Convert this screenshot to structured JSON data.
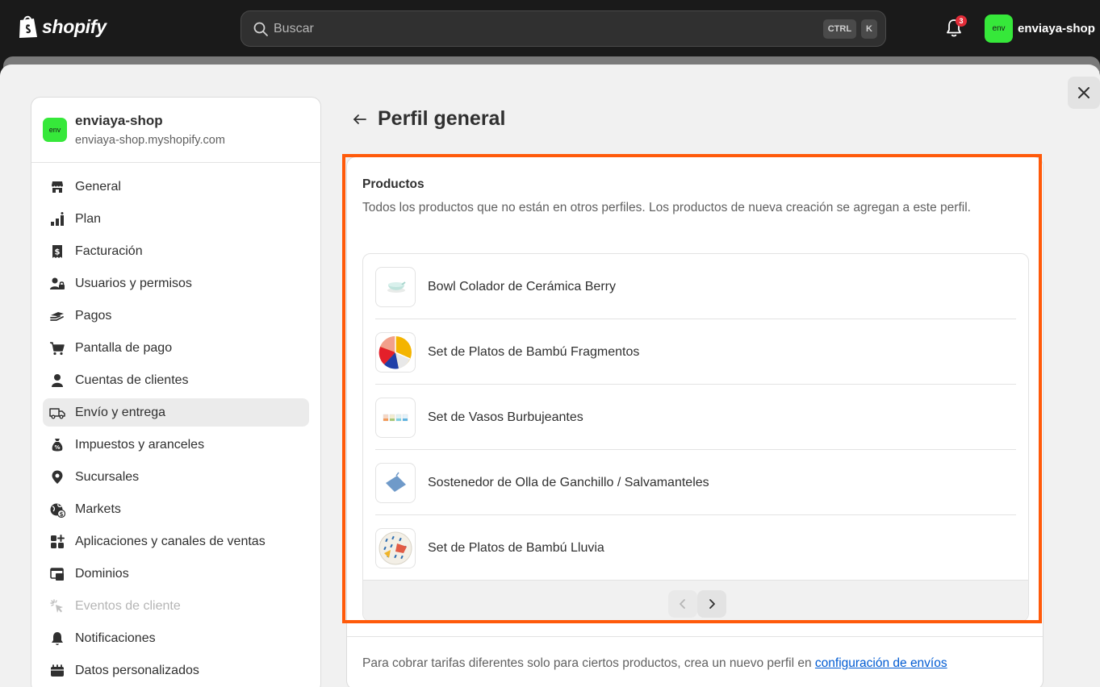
{
  "topbar": {
    "brand": "shopify",
    "search_placeholder": "Buscar",
    "shortcut_keys": [
      "CTRL",
      "K"
    ],
    "notification_count": "3",
    "store_avatar": "env",
    "store_name": "enviaya-shop"
  },
  "colors": {
    "accent_highlight": "#ff5a0a",
    "avatar_green": "#36e83a",
    "badge_red": "#e22c38",
    "link_blue": "#005bd3"
  },
  "sidebar": {
    "avatar": "env",
    "store_name": "enviaya-shop",
    "store_domain": "enviaya-shop.myshopify.com",
    "items": [
      {
        "label": "General",
        "icon": "store-icon"
      },
      {
        "label": "Plan",
        "icon": "plan-icon"
      },
      {
        "label": "Facturación",
        "icon": "receipt-dollar-icon"
      },
      {
        "label": "Usuarios y permisos",
        "icon": "users-lock-icon"
      },
      {
        "label": "Pagos",
        "icon": "hand-payment-icon"
      },
      {
        "label": "Pantalla de pago",
        "icon": "cart-icon"
      },
      {
        "label": "Cuentas de clientes",
        "icon": "person-icon"
      },
      {
        "label": "Envío y entrega",
        "icon": "truck-icon",
        "active": true
      },
      {
        "label": "Impuestos y aranceles",
        "icon": "tax-bag-icon"
      },
      {
        "label": "Sucursales",
        "icon": "location-pin-icon"
      },
      {
        "label": "Markets",
        "icon": "globe-dollar-icon"
      },
      {
        "label": "Aplicaciones y canales de ventas",
        "icon": "apps-icon"
      },
      {
        "label": "Dominios",
        "icon": "domains-icon"
      },
      {
        "label": "Eventos de cliente",
        "icon": "cursor-click-icon",
        "disabled": true
      },
      {
        "label": "Notificaciones",
        "icon": "bell-icon"
      },
      {
        "label": "Datos personalizados",
        "icon": "custom-data-icon"
      }
    ]
  },
  "main": {
    "page_title": "Perfil general",
    "products_card": {
      "title": "Productos",
      "description": "Todos los productos que no están en otros perfiles. Los productos de nueva creación se agregan a este perfil.",
      "products": [
        {
          "name": "Bowl Colador de Cerámica Berry",
          "thumb": "bowl-thumbnail"
        },
        {
          "name": "Set de Platos de Bambú Fragmentos",
          "thumb": "plates-fragments-thumbnail"
        },
        {
          "name": "Set de Vasos Burbujeantes",
          "thumb": "glasses-thumbnail"
        },
        {
          "name": "Sostenedor de Olla de Ganchillo / Salvamanteles",
          "thumb": "pot-holder-thumbnail"
        },
        {
          "name": "Set de Platos de Bambú Lluvia",
          "thumb": "plates-rain-thumbnail"
        }
      ]
    },
    "footer_text": "Para cobrar tarifas diferentes solo para ciertos productos, crea un nuevo perfil en ",
    "footer_link": "configuración de envíos"
  }
}
